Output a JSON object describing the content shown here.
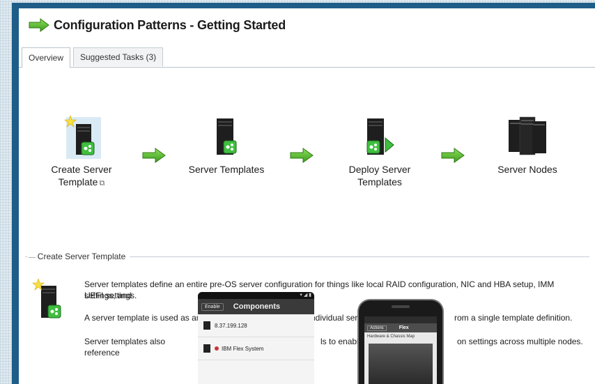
{
  "header": {
    "title": "Configuration Patterns - Getting Started"
  },
  "tabs": [
    {
      "label": "Overview",
      "active": true
    },
    {
      "label": "Suggested Tasks (3)",
      "active": false
    }
  ],
  "flow": [
    {
      "label_line1": "Create Server",
      "label_line2": "Template",
      "external_link": true,
      "icon": "server-template-new-icon"
    },
    {
      "label_line1": "Server Templates",
      "label_line2": "",
      "icon": "server-template-icon"
    },
    {
      "label_line1": "Deploy Server",
      "label_line2": "Templates",
      "icon": "deploy-template-icon"
    },
    {
      "label_line1": "Server Nodes",
      "label_line2": "",
      "icon": "server-nodes-icon"
    }
  ],
  "section": {
    "legend": "Create Server Template",
    "paragraphs": [
      "Server templates define an entire pre-OS server configuration for things like local RAID configuration, NIC and HBA setup, IMM settings, and",
      "UEFI settings.",
      "A server template is used as an",
      "ndividual ser",
      "rom a single template definition.",
      "Server templates also reference",
      "ls to enable r",
      "on settings across multiple nodes."
    ]
  },
  "overlay": {
    "android": {
      "back_label": "Enable",
      "title": "Components",
      "rows": [
        {
          "title": "8.37.199.128",
          "sub": ""
        },
        {
          "title": "IBM Flex System",
          "sub": ""
        }
      ]
    },
    "iphone": {
      "back_label": "Actions",
      "title": "Flex",
      "row": "Hardware & Chassis Map"
    }
  },
  "colors": {
    "frame": "#1f5d89",
    "arrow_green": "#5dbb2f",
    "server_black": "#1e1e1e",
    "status_green": "#3fbf3f"
  }
}
